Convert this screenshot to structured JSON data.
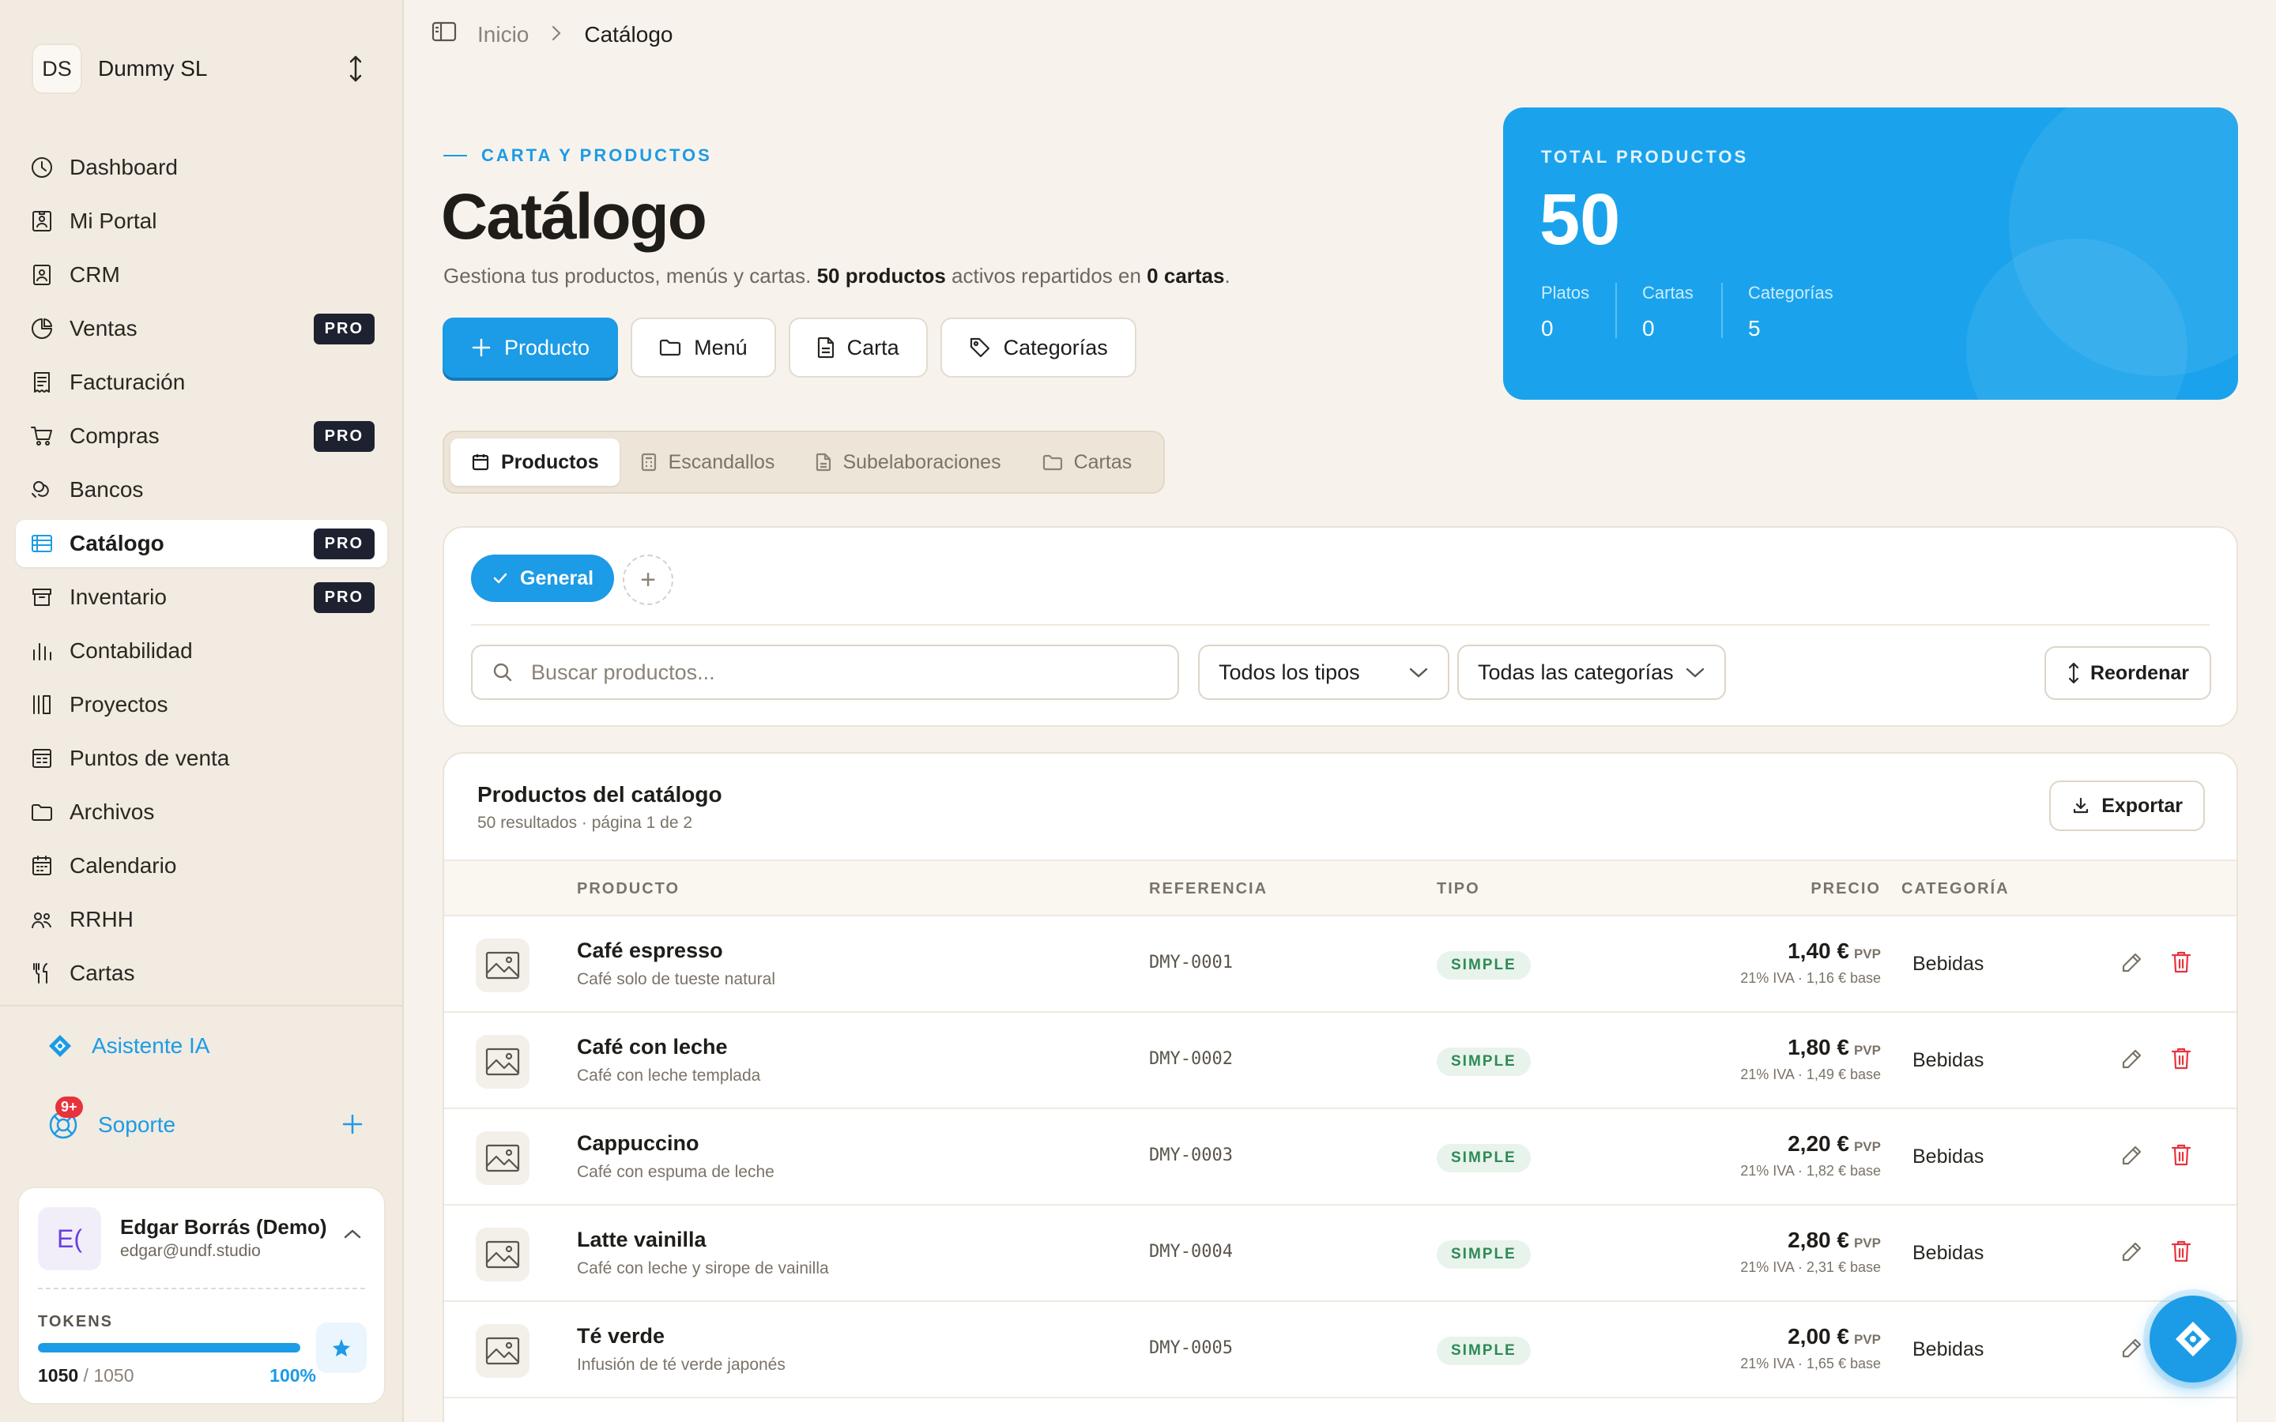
{
  "org": {
    "initials": "DS",
    "name": "Dummy SL"
  },
  "nav": [
    {
      "label": "Dashboard",
      "icon": "dashboard-icon",
      "pro": false,
      "active": false
    },
    {
      "label": "Mi Portal",
      "icon": "portal-icon",
      "pro": false,
      "active": false
    },
    {
      "label": "CRM",
      "icon": "crm-icon",
      "pro": false,
      "active": false
    },
    {
      "label": "Ventas",
      "icon": "sales-icon",
      "pro": true,
      "active": false
    },
    {
      "label": "Facturación",
      "icon": "invoice-icon",
      "pro": false,
      "active": false
    },
    {
      "label": "Compras",
      "icon": "cart-icon",
      "pro": true,
      "active": false
    },
    {
      "label": "Bancos",
      "icon": "bank-icon",
      "pro": false,
      "active": false
    },
    {
      "label": "Catálogo",
      "icon": "catalog-icon",
      "pro": true,
      "active": true
    },
    {
      "label": "Inventario",
      "icon": "inventory-icon",
      "pro": true,
      "active": false
    },
    {
      "label": "Contabilidad",
      "icon": "accounting-icon",
      "pro": false,
      "active": false
    },
    {
      "label": "Proyectos",
      "icon": "projects-icon",
      "pro": false,
      "active": false
    },
    {
      "label": "Puntos de venta",
      "icon": "pos-icon",
      "pro": false,
      "active": false
    },
    {
      "label": "Archivos",
      "icon": "folder-icon",
      "pro": false,
      "active": false
    },
    {
      "label": "Calendario",
      "icon": "calendar-icon",
      "pro": false,
      "active": false
    },
    {
      "label": "RRHH",
      "icon": "people-icon",
      "pro": false,
      "active": false
    },
    {
      "label": "Cartas",
      "icon": "utensils-icon",
      "pro": false,
      "active": false
    }
  ],
  "pro_label": "PRO",
  "assistant": {
    "label": "Asistente IA"
  },
  "support": {
    "label": "Soporte",
    "badge": "9+"
  },
  "user": {
    "initials": "E(",
    "name": "Edgar Borrás (Demo)",
    "email": "edgar@undf.studio",
    "tokens_label": "TOKENS",
    "tokens_used": "1050",
    "tokens_sep": " / ",
    "tokens_max": "1050",
    "tokens_pct": "100%",
    "tokens_fraction": 1.0
  },
  "breadcrumb": {
    "home": "Inicio",
    "current": "Catálogo"
  },
  "header": {
    "eyebrow": "CARTA Y PRODUCTOS",
    "title": "Catálogo",
    "desc_pre": "Gestiona tus productos, menús y cartas. ",
    "desc_products": "50 productos",
    "desc_mid": " activos repartidos en ",
    "desc_cartas": "0 cartas",
    "desc_end": "."
  },
  "actions": {
    "producto": "Producto",
    "menu": "Menú",
    "carta": "Carta",
    "categorias": "Categorías"
  },
  "stats": {
    "title": "TOTAL PRODUCTOS",
    "total": "50",
    "items": [
      {
        "label": "Platos",
        "value": "0"
      },
      {
        "label": "Cartas",
        "value": "0"
      },
      {
        "label": "Categorías",
        "value": "5"
      }
    ]
  },
  "tabs": [
    {
      "label": "Productos",
      "active": true
    },
    {
      "label": "Escandallos",
      "active": false
    },
    {
      "label": "Subelaboraciones",
      "active": false
    },
    {
      "label": "Cartas",
      "active": false
    }
  ],
  "filters": {
    "chip": "General",
    "add": "+",
    "search_placeholder": "Buscar productos...",
    "type_select": "Todos los tipos",
    "category_select": "Todas las categorías",
    "reorder": "Reordenar"
  },
  "table": {
    "title": "Productos del catálogo",
    "subtitle": "50 resultados · página 1 de 2",
    "export": "Exportar",
    "headers": {
      "product": "PRODUCTO",
      "ref": "REFERENCIA",
      "type": "TIPO",
      "price": "PRECIO",
      "category": "CATEGORÍA"
    },
    "rows": [
      {
        "name": "Café espresso",
        "desc": "Café solo de tueste natural",
        "ref": "DMY-0001",
        "type": "SIMPLE",
        "price": "1,40 €",
        "pvp": "PVP",
        "tax": "21% IVA · 1,16 € base",
        "category": "Bebidas"
      },
      {
        "name": "Café con leche",
        "desc": "Café con leche templada",
        "ref": "DMY-0002",
        "type": "SIMPLE",
        "price": "1,80 €",
        "pvp": "PVP",
        "tax": "21% IVA · 1,49 € base",
        "category": "Bebidas"
      },
      {
        "name": "Cappuccino",
        "desc": "Café con espuma de leche",
        "ref": "DMY-0003",
        "type": "SIMPLE",
        "price": "2,20 €",
        "pvp": "PVP",
        "tax": "21% IVA · 1,82 € base",
        "category": "Bebidas"
      },
      {
        "name": "Latte vainilla",
        "desc": "Café con leche y sirope de vainilla",
        "ref": "DMY-0004",
        "type": "SIMPLE",
        "price": "2,80 €",
        "pvp": "PVP",
        "tax": "21% IVA · 2,31 € base",
        "category": "Bebidas"
      },
      {
        "name": "Té verde",
        "desc": "Infusión de té verde japonés",
        "ref": "DMY-0005",
        "type": "SIMPLE",
        "price": "2,00 €",
        "pvp": "PVP",
        "tax": "21% IVA · 1,65 € base",
        "category": "Bebidas"
      }
    ]
  },
  "colors": {
    "accent": "#1c9be6",
    "sidebar_bg": "#f1ebe1",
    "page_bg": "#f7f3ec",
    "pro_badge": "#1e2230",
    "danger": "#e8323c",
    "success": "#2e8a55"
  }
}
